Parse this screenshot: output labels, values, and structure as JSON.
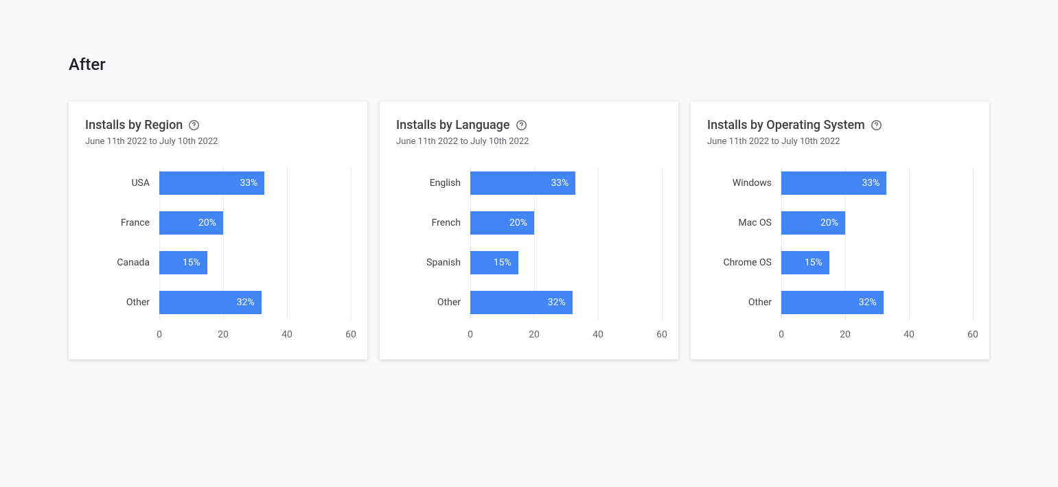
{
  "page_title": "After",
  "date_range": "June 11th 2022 to July 10th 2022",
  "axis": {
    "min": 0,
    "max": 60,
    "ticks": [
      0,
      20,
      40,
      60
    ]
  },
  "cards": [
    {
      "title": "Installs by Region",
      "rows": [
        {
          "label": "USA",
          "value": 33,
          "display": "33%"
        },
        {
          "label": "France",
          "value": 20,
          "display": "20%"
        },
        {
          "label": "Canada",
          "value": 15,
          "display": "15%"
        },
        {
          "label": "Other",
          "value": 32,
          "display": "32%"
        }
      ]
    },
    {
      "title": "Installs by Language",
      "rows": [
        {
          "label": "English",
          "value": 33,
          "display": "33%"
        },
        {
          "label": "French",
          "value": 20,
          "display": "20%"
        },
        {
          "label": "Spanish",
          "value": 15,
          "display": "15%"
        },
        {
          "label": "Other",
          "value": 32,
          "display": "32%"
        }
      ]
    },
    {
      "title": "Installs by Operating System",
      "rows": [
        {
          "label": "Windows",
          "value": 33,
          "display": "33%"
        },
        {
          "label": "Mac OS",
          "value": 20,
          "display": "20%"
        },
        {
          "label": "Chrome OS",
          "value": 15,
          "display": "15%"
        },
        {
          "label": "Other",
          "value": 32,
          "display": "32%"
        }
      ]
    }
  ],
  "chart_data": [
    {
      "type": "bar",
      "title": "Installs by Region",
      "subtitle": "June 11th 2022 to July 10th 2022",
      "categories": [
        "USA",
        "France",
        "Canada",
        "Other"
      ],
      "values": [
        33,
        20,
        15,
        32
      ],
      "xlabel": "",
      "ylabel": "",
      "xlim": [
        0,
        60
      ],
      "orientation": "horizontal"
    },
    {
      "type": "bar",
      "title": "Installs by Language",
      "subtitle": "June 11th 2022 to July 10th 2022",
      "categories": [
        "English",
        "French",
        "Spanish",
        "Other"
      ],
      "values": [
        33,
        20,
        15,
        32
      ],
      "xlabel": "",
      "ylabel": "",
      "xlim": [
        0,
        60
      ],
      "orientation": "horizontal"
    },
    {
      "type": "bar",
      "title": "Installs by Operating System",
      "subtitle": "June 11th 2022 to July 10th 2022",
      "categories": [
        "Windows",
        "Mac OS",
        "Chrome OS",
        "Other"
      ],
      "values": [
        33,
        20,
        15,
        32
      ],
      "xlabel": "",
      "ylabel": "",
      "xlim": [
        0,
        60
      ],
      "orientation": "horizontal"
    }
  ]
}
